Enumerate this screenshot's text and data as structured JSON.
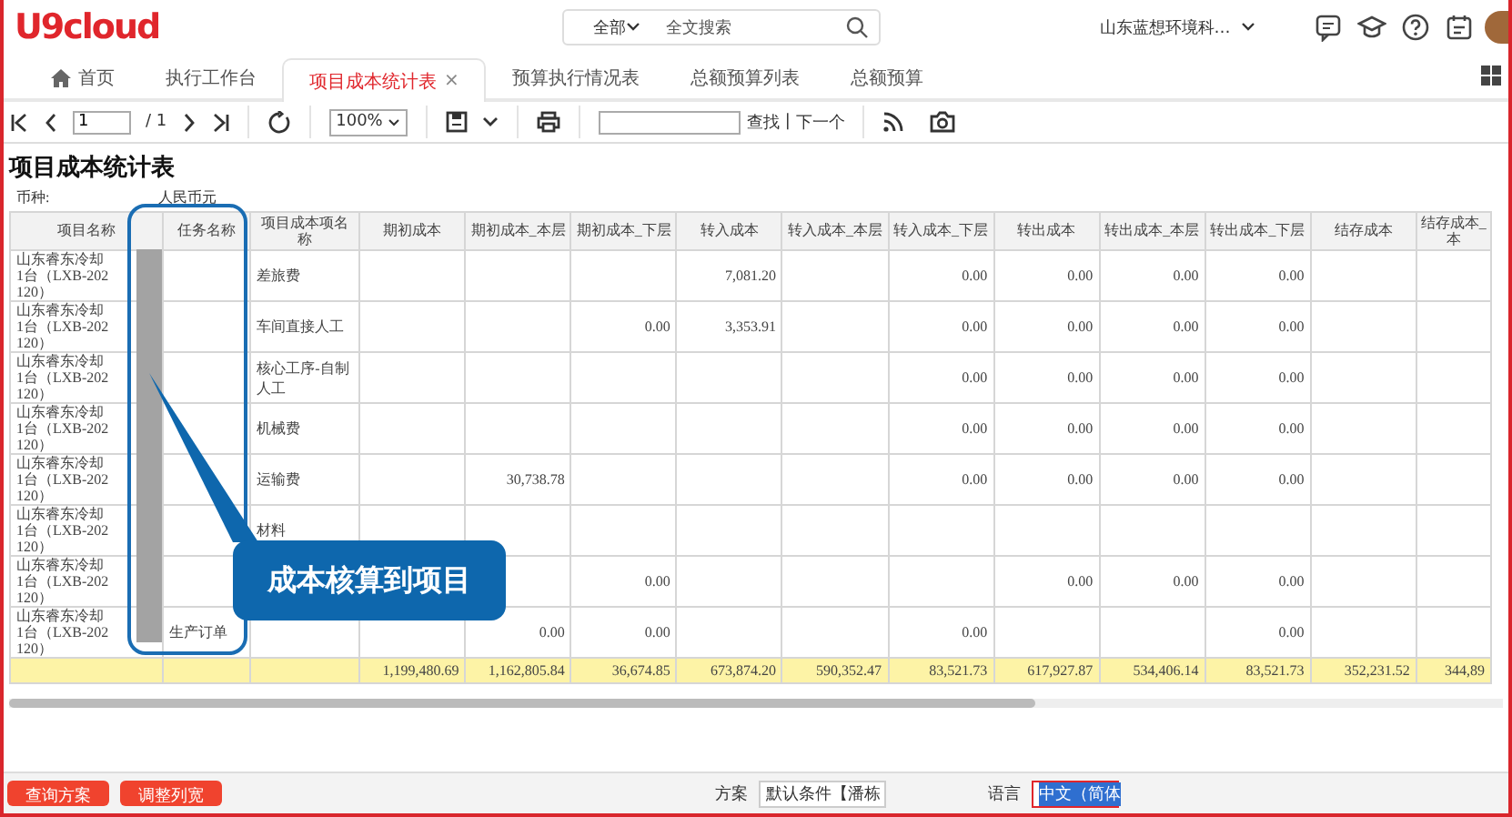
{
  "header": {
    "logo": "U9cloud",
    "search_scope": "全部",
    "search_placeholder": "全文搜索",
    "organization": "山东蓝想环境科…"
  },
  "tabs": [
    {
      "label": "首页",
      "kind": "home",
      "selected": false
    },
    {
      "label": "执行工作台",
      "kind": "plain",
      "selected": false
    },
    {
      "label": "项目成本统计表",
      "kind": "plain",
      "selected": true,
      "close": "×"
    },
    {
      "label": "预算执行情况表",
      "kind": "plain",
      "selected": false
    },
    {
      "label": "总额预算列表",
      "kind": "plain",
      "selected": false
    },
    {
      "label": "总额预算",
      "kind": "plain",
      "selected": false
    }
  ],
  "toolbar": {
    "page": "1",
    "page_total": "/ 1",
    "zoom": "100%",
    "find_button": "查找",
    "separator": "|",
    "next_button": "下一个"
  },
  "report": {
    "title": "项目成本统计表",
    "currency_label": "币种:",
    "currency": "人民币元",
    "columns": [
      "项目名称",
      "任务名称",
      "项目成本项名称",
      "期初成本",
      "期初成本_本层",
      "期初成本_下层",
      "转入成本",
      "转入成本_本层",
      "转入成本_下层",
      "转出成本",
      "转出成本_本层",
      "转出成本_下层",
      "结存成本",
      "结存成本_本"
    ],
    "rows": [
      {
        "project": [
          "山东睿东冷却",
          "1台（LXB-202",
          "120）"
        ],
        "cost_item": "差旅费",
        "values": {
          "in": "7,081.20",
          "in_lower": "0.00",
          "out": "0.00",
          "out_this": "0.00",
          "out_lower": "0.00"
        }
      },
      {
        "project": [
          "山东睿东冷却",
          "1台（LXB-202",
          "120）"
        ],
        "cost_item": "车间直接人工",
        "values": {
          "opening_lower": "0.00",
          "in": "3,353.91",
          "in_lower": "0.00",
          "out": "0.00",
          "out_this": "0.00",
          "out_lower": "0.00"
        }
      },
      {
        "project": [
          "山东睿东冷却",
          "1台（LXB-202",
          "120）"
        ],
        "cost_item": "核心工序-自制人工",
        "values": {
          "in_lower": "0.00",
          "out": "0.00",
          "out_this": "0.00",
          "out_lower": "0.00"
        }
      },
      {
        "project": [
          "山东睿东冷却",
          "1台（LXB-202",
          "120）"
        ],
        "cost_item": "机械费",
        "values": {
          "in_lower": "0.00",
          "out": "0.00",
          "out_this": "0.00",
          "out_lower": "0.00"
        }
      },
      {
        "project": [
          "山东睿东冷却",
          "1台（LXB-202",
          "120）"
        ],
        "cost_item": "运输费",
        "values": {
          "opening_this": "30,738.78",
          "in_lower": "0.00",
          "out": "0.00",
          "out_this": "0.00",
          "out_lower": "0.00"
        }
      },
      {
        "project": [
          "山东睿东冷却",
          "1台（LXB-202",
          "120）"
        ],
        "cost_item": "材料",
        "values": {}
      },
      {
        "project": [
          "山东睿东冷却",
          "1台（LXB-202",
          "120）"
        ],
        "values": {
          "opening_lower": "0.00",
          "out": "0.00",
          "out_this": "0.00",
          "out_lower": "0.00"
        }
      },
      {
        "project": [
          "山东睿东冷却",
          "1台（LXB-202",
          "120）"
        ],
        "task": "生产订单",
        "values": {
          "opening_this": "0.00",
          "opening_lower": "0.00",
          "in_lower": "0.00",
          "out_lower": "0.00"
        }
      }
    ],
    "total": [
      "1,199,480.69",
      "1,162,805.84",
      "36,674.85",
      "673,874.20",
      "590,352.47",
      "83,521.73",
      "617,927.87",
      "534,406.14",
      "83,521.73",
      "352,231.52",
      "344,89"
    ]
  },
  "annotation": {
    "callout": "成本核算到项目"
  },
  "bottom_bar": {
    "buttons": [
      "查询方案",
      "调整列宽"
    ],
    "scheme_label": "方案",
    "scheme": "默认条件【潘栋",
    "language_label": "语言",
    "language": "中文（简体"
  }
}
